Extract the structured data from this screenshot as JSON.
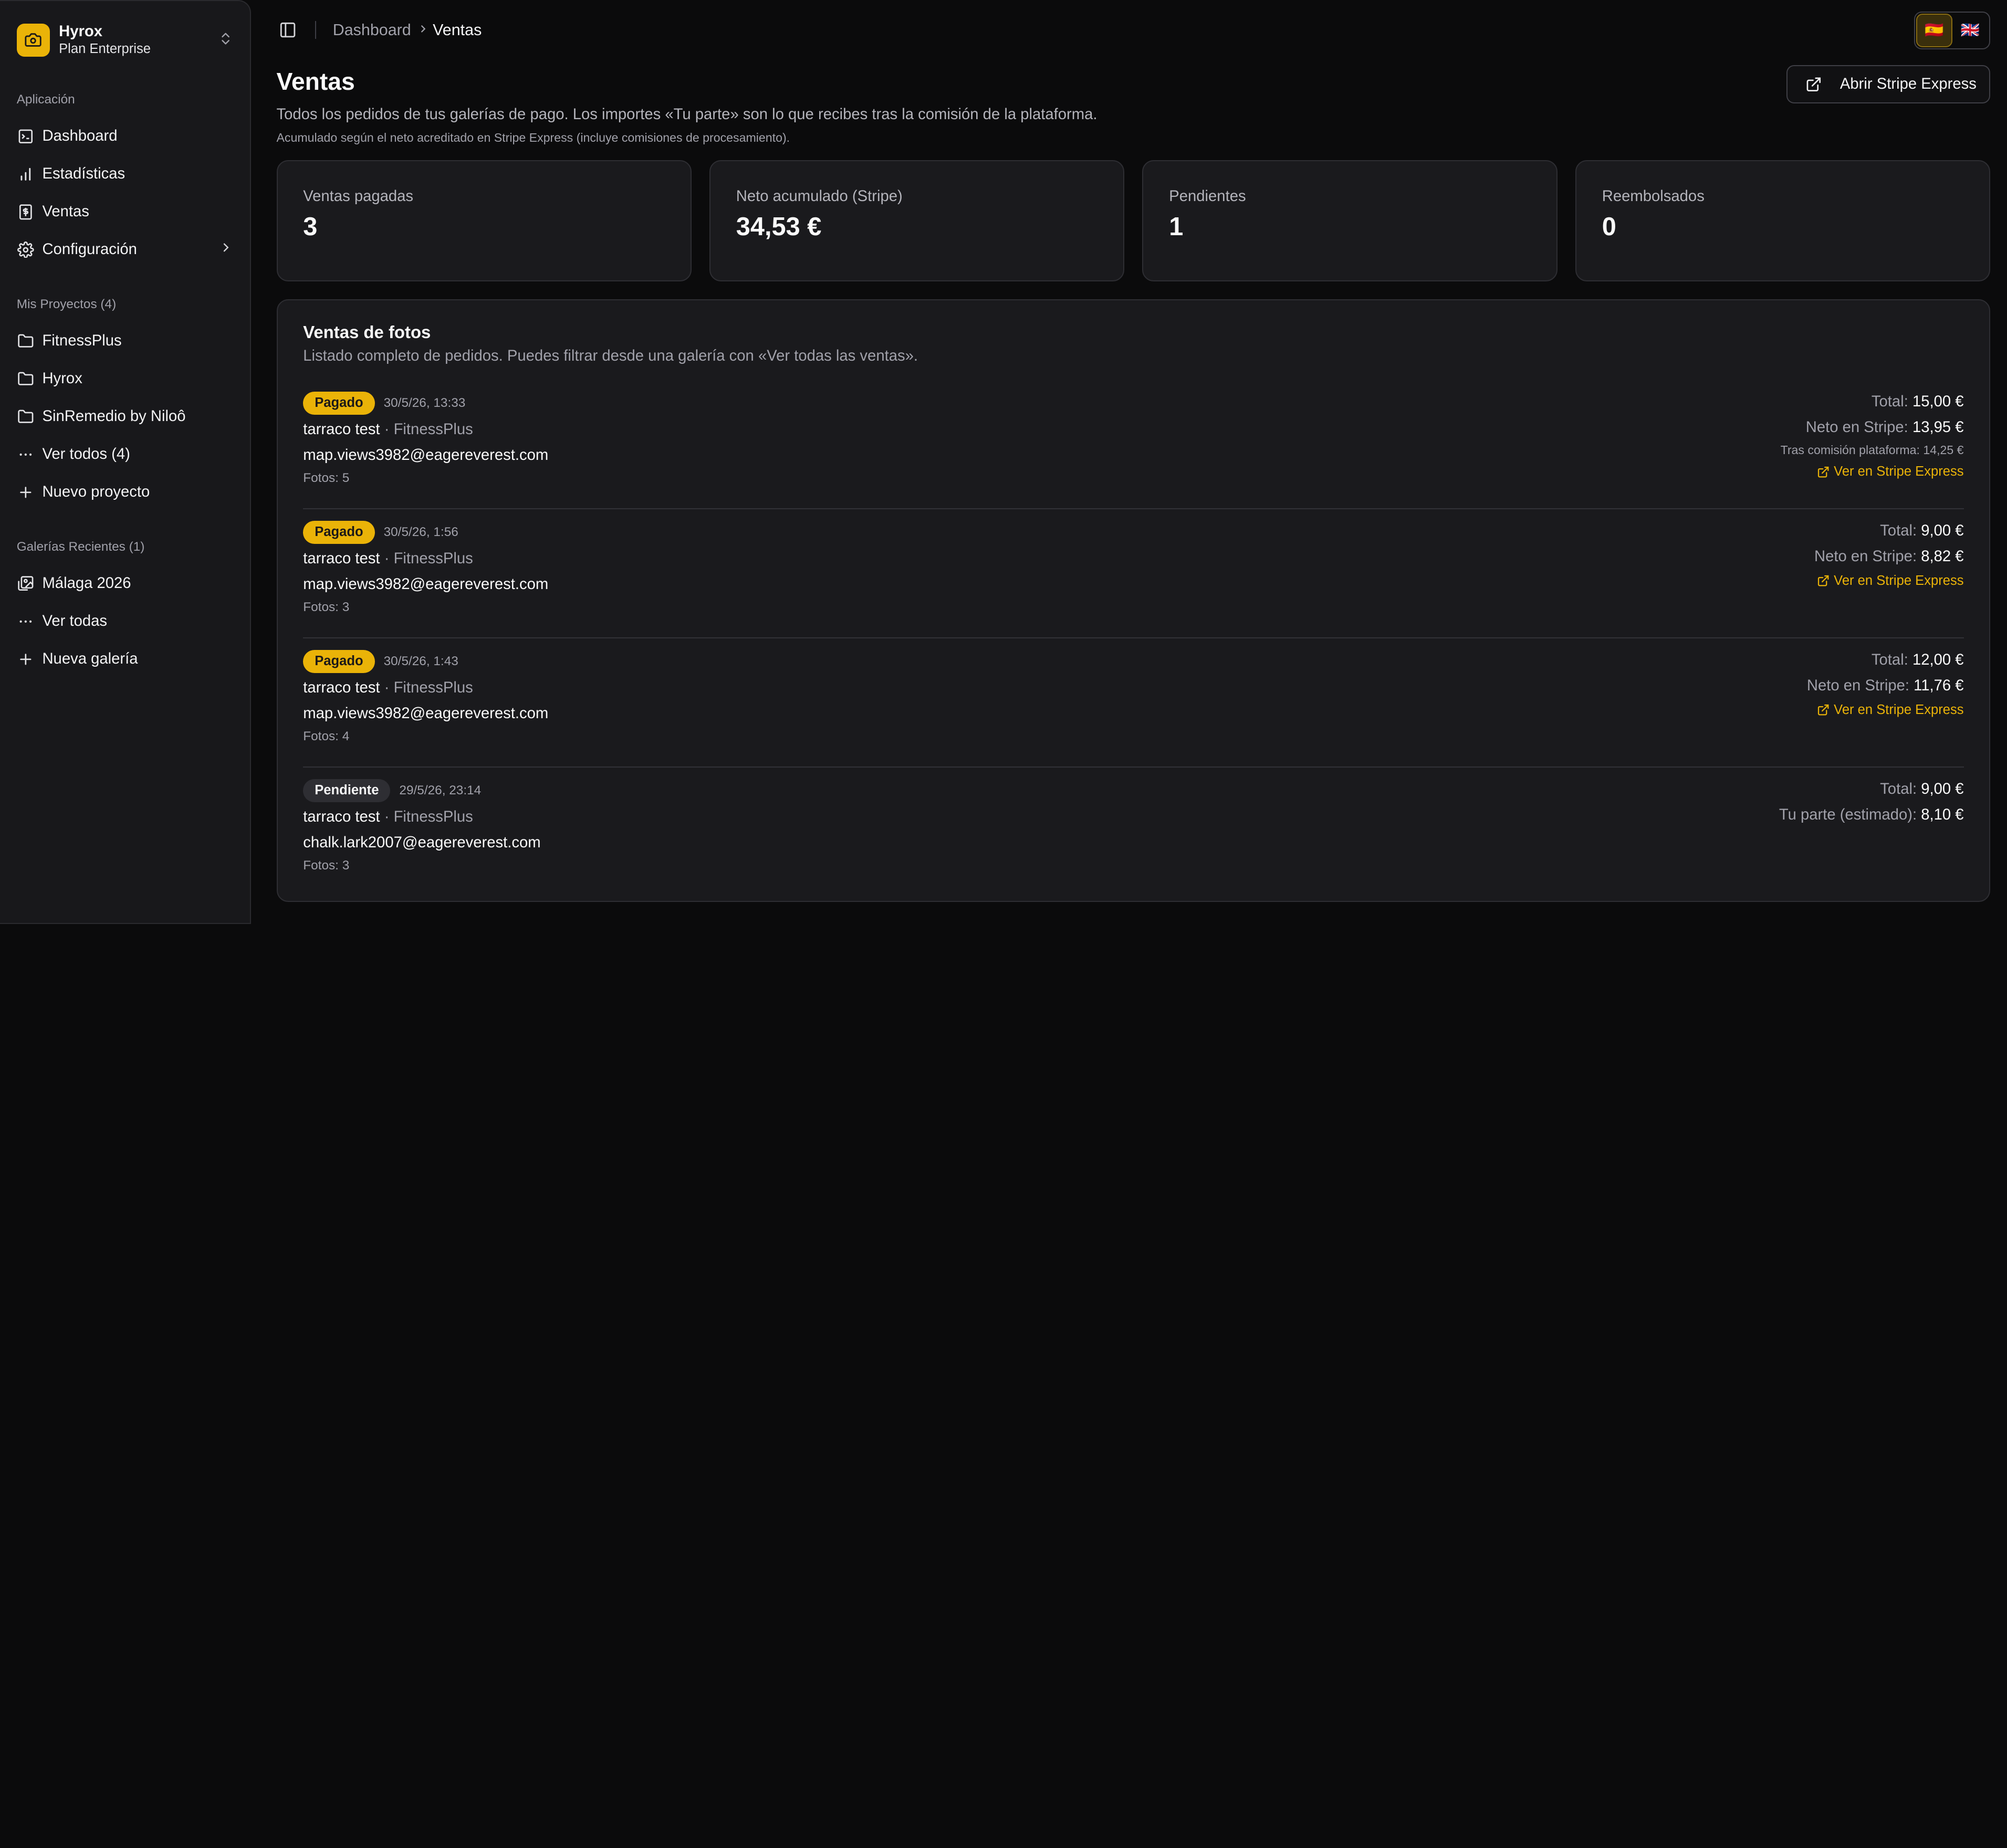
{
  "brand": {
    "name": "Hyrox",
    "plan": "Plan Enterprise"
  },
  "sidebar": {
    "app_group": {
      "label": "Aplicación",
      "items": [
        {
          "label": "Dashboard",
          "icon": "dashboard-icon"
        },
        {
          "label": "Estadísticas",
          "icon": "bar-chart-icon"
        },
        {
          "label": "Ventas",
          "icon": "receipt-icon"
        },
        {
          "label": "Configuración",
          "icon": "gear-icon"
        }
      ]
    },
    "projects_group": {
      "label": "Mis Proyectos (4)",
      "items": [
        {
          "label": "FitnessPlus",
          "icon": "folder-icon"
        },
        {
          "label": "Hyrox",
          "icon": "folder-icon"
        },
        {
          "label": "SinRemedio by Niloô",
          "icon": "folder-icon"
        },
        {
          "label": "Ver todos (4)",
          "icon": "ellipsis-icon"
        },
        {
          "label": "Nuevo proyecto",
          "icon": "plus-icon"
        }
      ]
    },
    "galleries_group": {
      "label": "Galerías Recientes (1)",
      "items": [
        {
          "label": "Málaga 2026",
          "icon": "images-icon"
        },
        {
          "label": "Ver todas",
          "icon": "ellipsis-icon"
        },
        {
          "label": "Nueva galería",
          "icon": "plus-icon"
        }
      ]
    }
  },
  "breadcrumb": {
    "parent": "Dashboard",
    "current": "Ventas"
  },
  "languages": {
    "active": "🇪🇸",
    "other": "🇬🇧"
  },
  "page": {
    "title": "Ventas",
    "subtitle": "Todos los pedidos de tus galerías de pago. Los importes «Tu parte» son lo que recibes tras la comisión de la plataforma.",
    "note": "Acumulado según el neto acreditado en Stripe Express (incluye comisiones de procesamiento).",
    "stripe_button": "Abrir Stripe Express"
  },
  "stats": [
    {
      "label": "Ventas pagadas",
      "value": "3"
    },
    {
      "label": "Neto acumulado (Stripe)",
      "value": "34,53 €"
    },
    {
      "label": "Pendientes",
      "value": "1"
    },
    {
      "label": "Reembolsados",
      "value": "0"
    }
  ],
  "sales_panel": {
    "title": "Ventas de fotos",
    "description": "Listado completo de pedidos. Puedes filtrar desde una galería con «Ver todas las ventas».",
    "orders": [
      {
        "status": "Pagado",
        "date": "30/5/26, 13:33",
        "name": "tarraco test",
        "gallery": "FitnessPlus",
        "email": "map.views3982@eagereverest.com",
        "photos": "Fotos: 5",
        "total_label": "Total:",
        "total": "15,00 €",
        "net_label": "Neto en Stripe:",
        "net": "13,95 €",
        "commission": "Tras comisión plataforma: 14,25 €",
        "link": "Ver en Stripe Express"
      },
      {
        "status": "Pagado",
        "date": "30/5/26, 1:56",
        "name": "tarraco test",
        "gallery": "FitnessPlus",
        "email": "map.views3982@eagereverest.com",
        "photos": "Fotos: 3",
        "total_label": "Total:",
        "total": "9,00 €",
        "net_label": "Neto en Stripe:",
        "net": "8,82 €",
        "link": "Ver en Stripe Express"
      },
      {
        "status": "Pagado",
        "date": "30/5/26, 1:43",
        "name": "tarraco test",
        "gallery": "FitnessPlus",
        "email": "map.views3982@eagereverest.com",
        "photos": "Fotos: 4",
        "total_label": "Total:",
        "total": "12,00 €",
        "net_label": "Neto en Stripe:",
        "net": "11,76 €",
        "link": "Ver en Stripe Express"
      },
      {
        "status": "Pendiente",
        "date": "29/5/26, 23:14",
        "name": "tarraco test",
        "gallery": "FitnessPlus",
        "email": "chalk.lark2007@eagereverest.com",
        "photos": "Fotos: 3",
        "total_label": "Total:",
        "total": "9,00 €",
        "net_label": "Tu parte (estimado):",
        "net": "8,10 €"
      }
    ]
  },
  "colors": {
    "accent": "#eab308",
    "background": "#0b0b0c",
    "card": "#1a1a1d"
  }
}
